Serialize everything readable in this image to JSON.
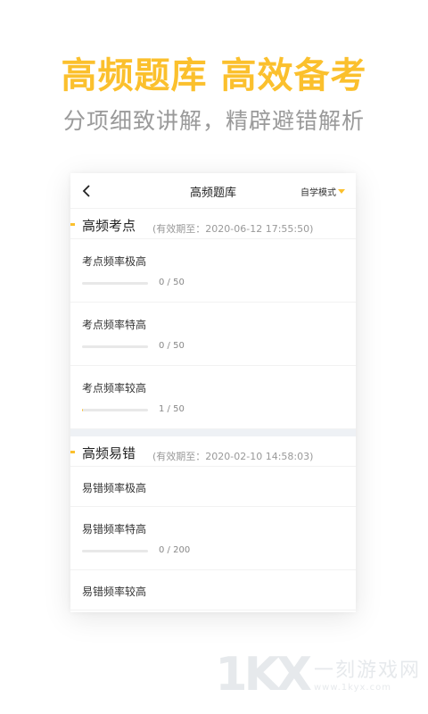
{
  "hero": {
    "title": "高频题库 高效备考",
    "subtitle": "分项细致讲解，精辟避错解析"
  },
  "nav": {
    "title": "高频题库",
    "mode_label": "自学模式"
  },
  "sections": [
    {
      "title": "高频考点",
      "meta": "(有效期至：2020-06-12 17:55:50)",
      "items": [
        {
          "label": "考点频率极高",
          "progress_text": "0 / 50",
          "progress": 0
        },
        {
          "label": "考点频率特高",
          "progress_text": "0 / 50",
          "progress": 0
        },
        {
          "label": "考点频率较高",
          "progress_text": "1 / 50",
          "progress": 0.02
        }
      ]
    },
    {
      "title": "高频易错",
      "meta": "(有效期至：2020-02-10 14:58:03)",
      "items": [
        {
          "label": "易错频率极高"
        },
        {
          "label": "易错频率特高",
          "progress_text": "0 / 200",
          "progress": 0
        },
        {
          "label": "易错频率较高"
        }
      ]
    }
  ],
  "watermark": {
    "logo": "1KX",
    "name": "一刻游戏网",
    "url": "www.1kyx.com"
  },
  "colors": {
    "accent": "#fbc02d",
    "muted_text": "#9a9a9a"
  }
}
